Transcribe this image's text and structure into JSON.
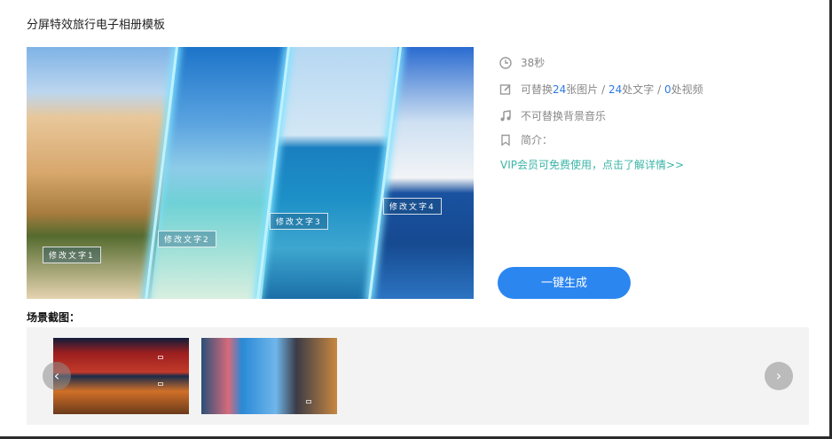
{
  "dialog": {
    "title": "分屏特效旅行电子相册模板"
  },
  "preview": {
    "captions": [
      "修改文字1",
      "修改文字2",
      "修改文字3",
      "修改文字4"
    ]
  },
  "meta": {
    "duration": "38秒",
    "replace_prefix": "可替换",
    "image_count": "24",
    "image_suffix": "张图片 / ",
    "text_count": "24",
    "text_suffix": "处文字 / ",
    "video_count": "0",
    "video_suffix": "处视频",
    "music": "不可替换背景音乐",
    "intro_label": "简介：",
    "vip_link": "VIP会员可免费使用，点击了解详情>>"
  },
  "generate_button": "一键生成",
  "scenes": {
    "label": "场景截图：",
    "prev": "‹",
    "next": "›"
  },
  "colors": {
    "accent": "#2c86f0",
    "vip": "#3bb5a6",
    "number": "#2c7be5"
  }
}
